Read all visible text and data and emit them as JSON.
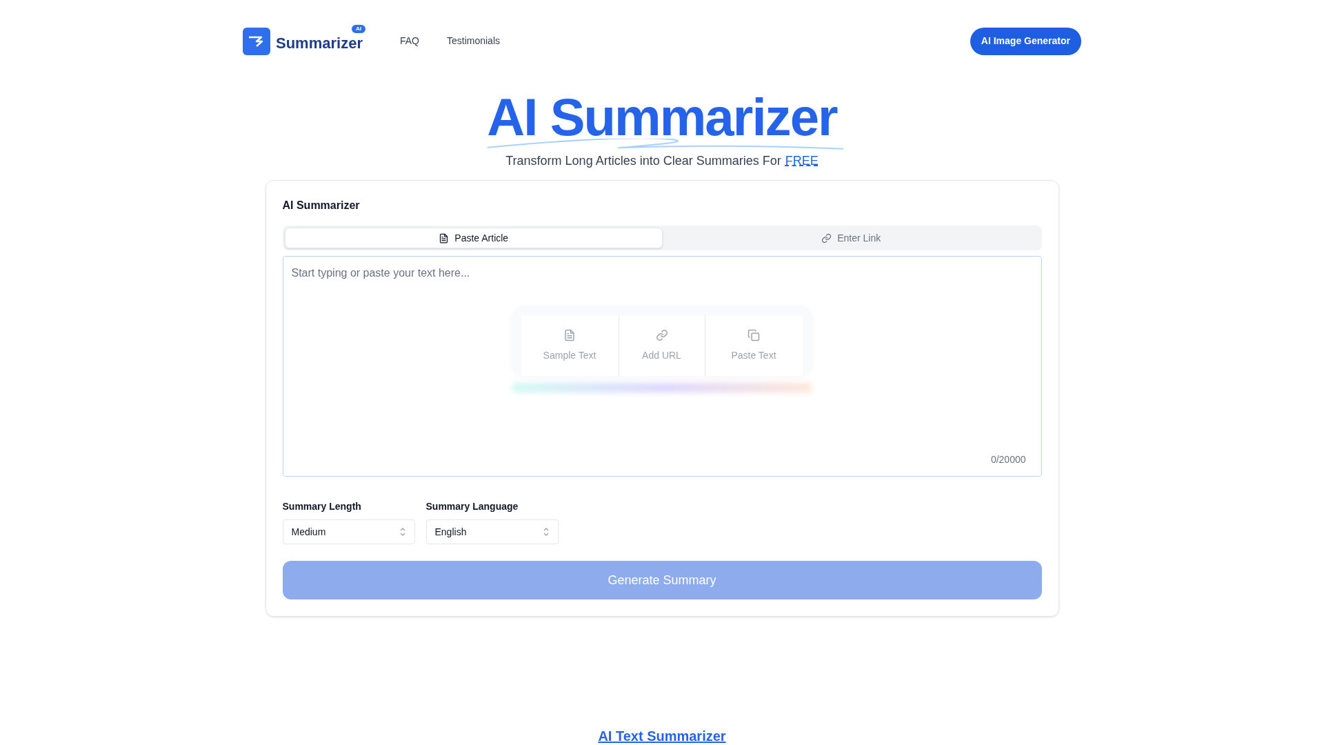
{
  "header": {
    "logo": {
      "text": "Summarizer",
      "badge": "AI"
    },
    "nav": [
      "FAQ",
      "Testimonials"
    ],
    "cta": "AI Image Generator"
  },
  "hero": {
    "title": "AI Summarizer",
    "subtitle": "Transform Long Articles into Clear Summaries For",
    "subtitle_link": "FREE"
  },
  "card": {
    "title": "AI Summarizer",
    "tabs": [
      {
        "label": "Paste Article",
        "kind": "document",
        "selected": true
      },
      {
        "label": "Enter Link",
        "kind": "link",
        "selected": false
      }
    ],
    "textarea": {
      "placeholder": "Start typing or paste your text here...",
      "counter": "0/20000"
    },
    "quick_actions": [
      {
        "label": "Sample Text",
        "kind": "document"
      },
      {
        "label": "Add URL",
        "kind": "link"
      },
      {
        "label": "Paste Text",
        "kind": "copy"
      }
    ],
    "selects": [
      {
        "label": "Summary Length",
        "value": "Medium"
      },
      {
        "label": "Summary Language",
        "value": "English"
      }
    ],
    "button": {
      "label": "Generate Summary",
      "disabled": true
    }
  },
  "footer_heading": "AI Text Summarizer"
}
